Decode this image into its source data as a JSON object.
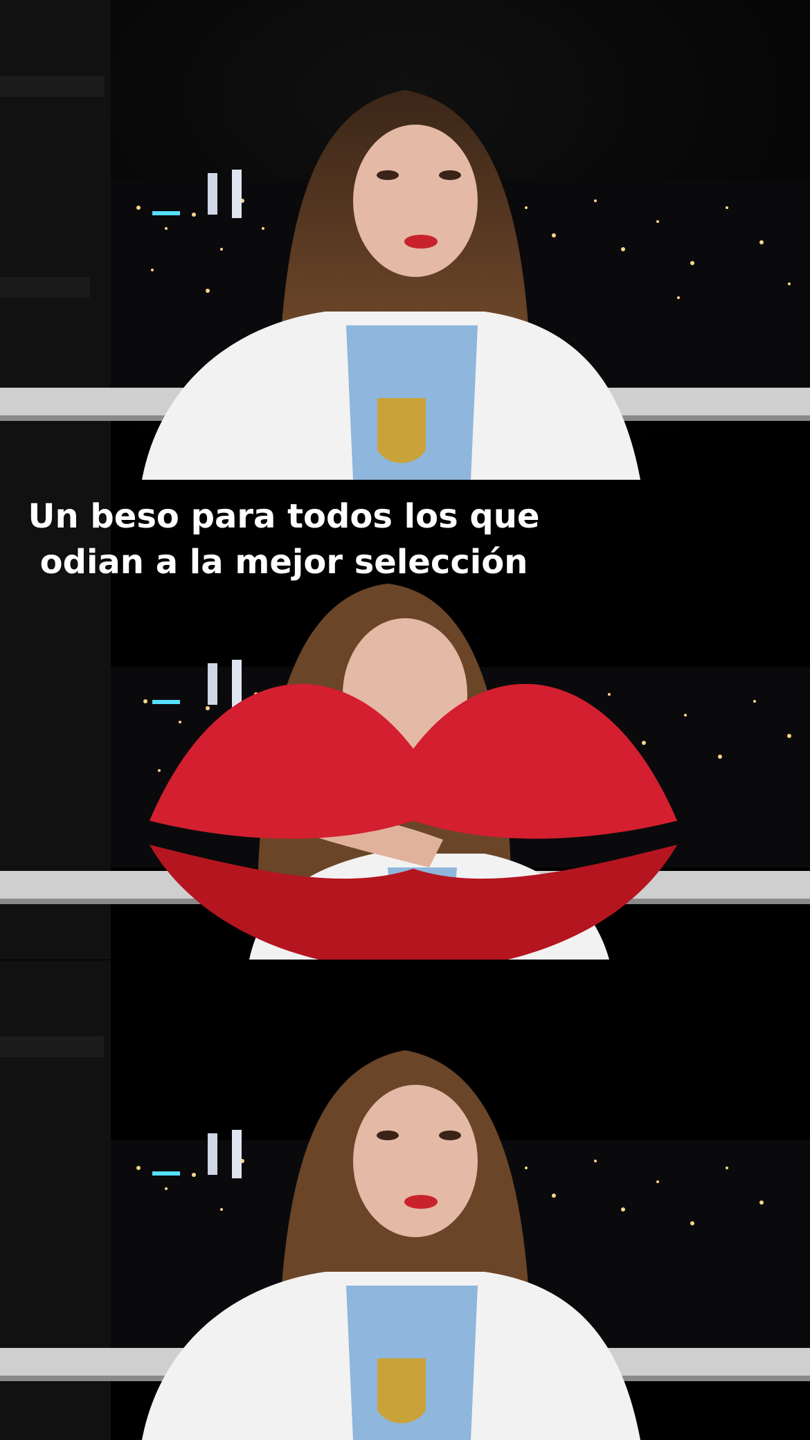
{
  "caption": {
    "line1": "Un beso para todos los que",
    "line2": "odian a la mejor selección"
  },
  "icons": {
    "caption_emoji": "kiss-mark-icon"
  },
  "colors": {
    "night_sky": "#050505",
    "jersey_blue": "#8fb6dc",
    "jersey_white": "#f2f2f2",
    "badge_gold": "#c9a33a",
    "hair_brown": "#5a3a24",
    "railing": "#d8d8d8",
    "caption_text": "#ffffff",
    "lips_red": "#c8232c"
  }
}
